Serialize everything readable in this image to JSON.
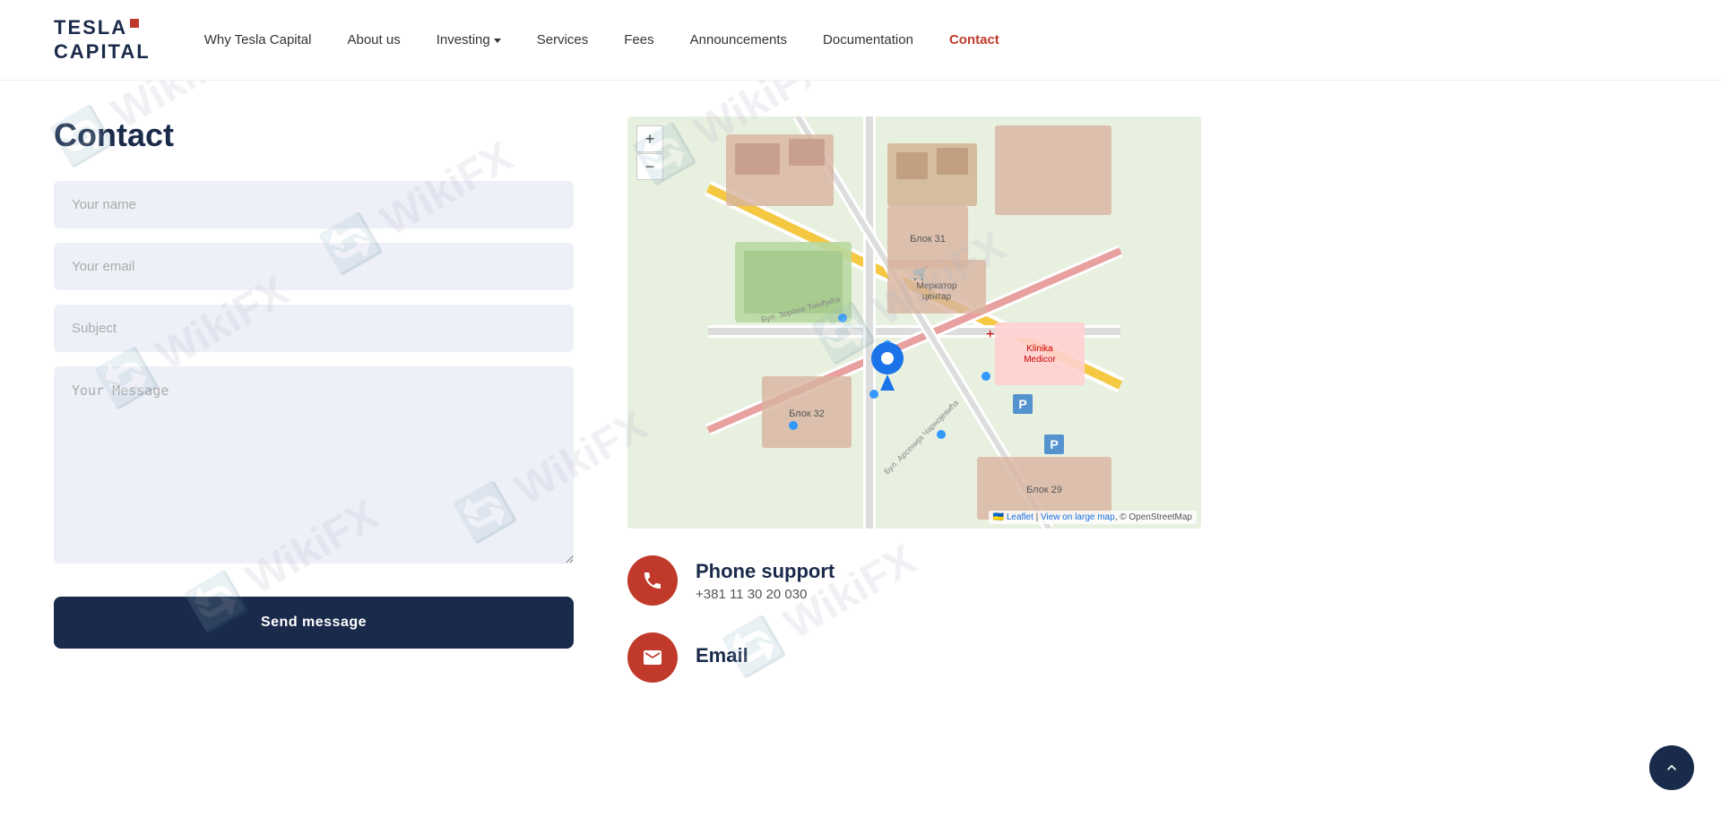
{
  "logo": {
    "line1": "TESLA",
    "line2": "CAPITAL"
  },
  "nav": {
    "items": [
      {
        "label": "Why Tesla Capital",
        "href": "#",
        "active": false
      },
      {
        "label": "About us",
        "href": "#",
        "active": false
      },
      {
        "label": "Investing",
        "href": "#",
        "active": false,
        "hasDropdown": true
      },
      {
        "label": "Services",
        "href": "#",
        "active": false
      },
      {
        "label": "Fees",
        "href": "#",
        "active": false
      },
      {
        "label": "Announcements",
        "href": "#",
        "active": false
      },
      {
        "label": "Documentation",
        "href": "#",
        "active": false
      },
      {
        "label": "Contact",
        "href": "#",
        "active": true
      }
    ]
  },
  "page": {
    "title": "Contact"
  },
  "form": {
    "name_placeholder": "Your name",
    "email_placeholder": "Your email",
    "subject_placeholder": "Subject",
    "message_placeholder": "Your Message",
    "send_label": "Send message"
  },
  "map": {
    "zoom_in": "+",
    "zoom_out": "−",
    "attribution_leaflet": "Leaflet",
    "attribution_view": "View on large map",
    "attribution_osm": "© OpenStreetMap"
  },
  "contact_items": [
    {
      "id": "phone",
      "label": "Phone support",
      "value": "+381 11 30 20 030",
      "icon": "phone"
    },
    {
      "id": "email",
      "label": "Email",
      "value": "",
      "icon": "email"
    }
  ],
  "scroll_top_label": "↑"
}
